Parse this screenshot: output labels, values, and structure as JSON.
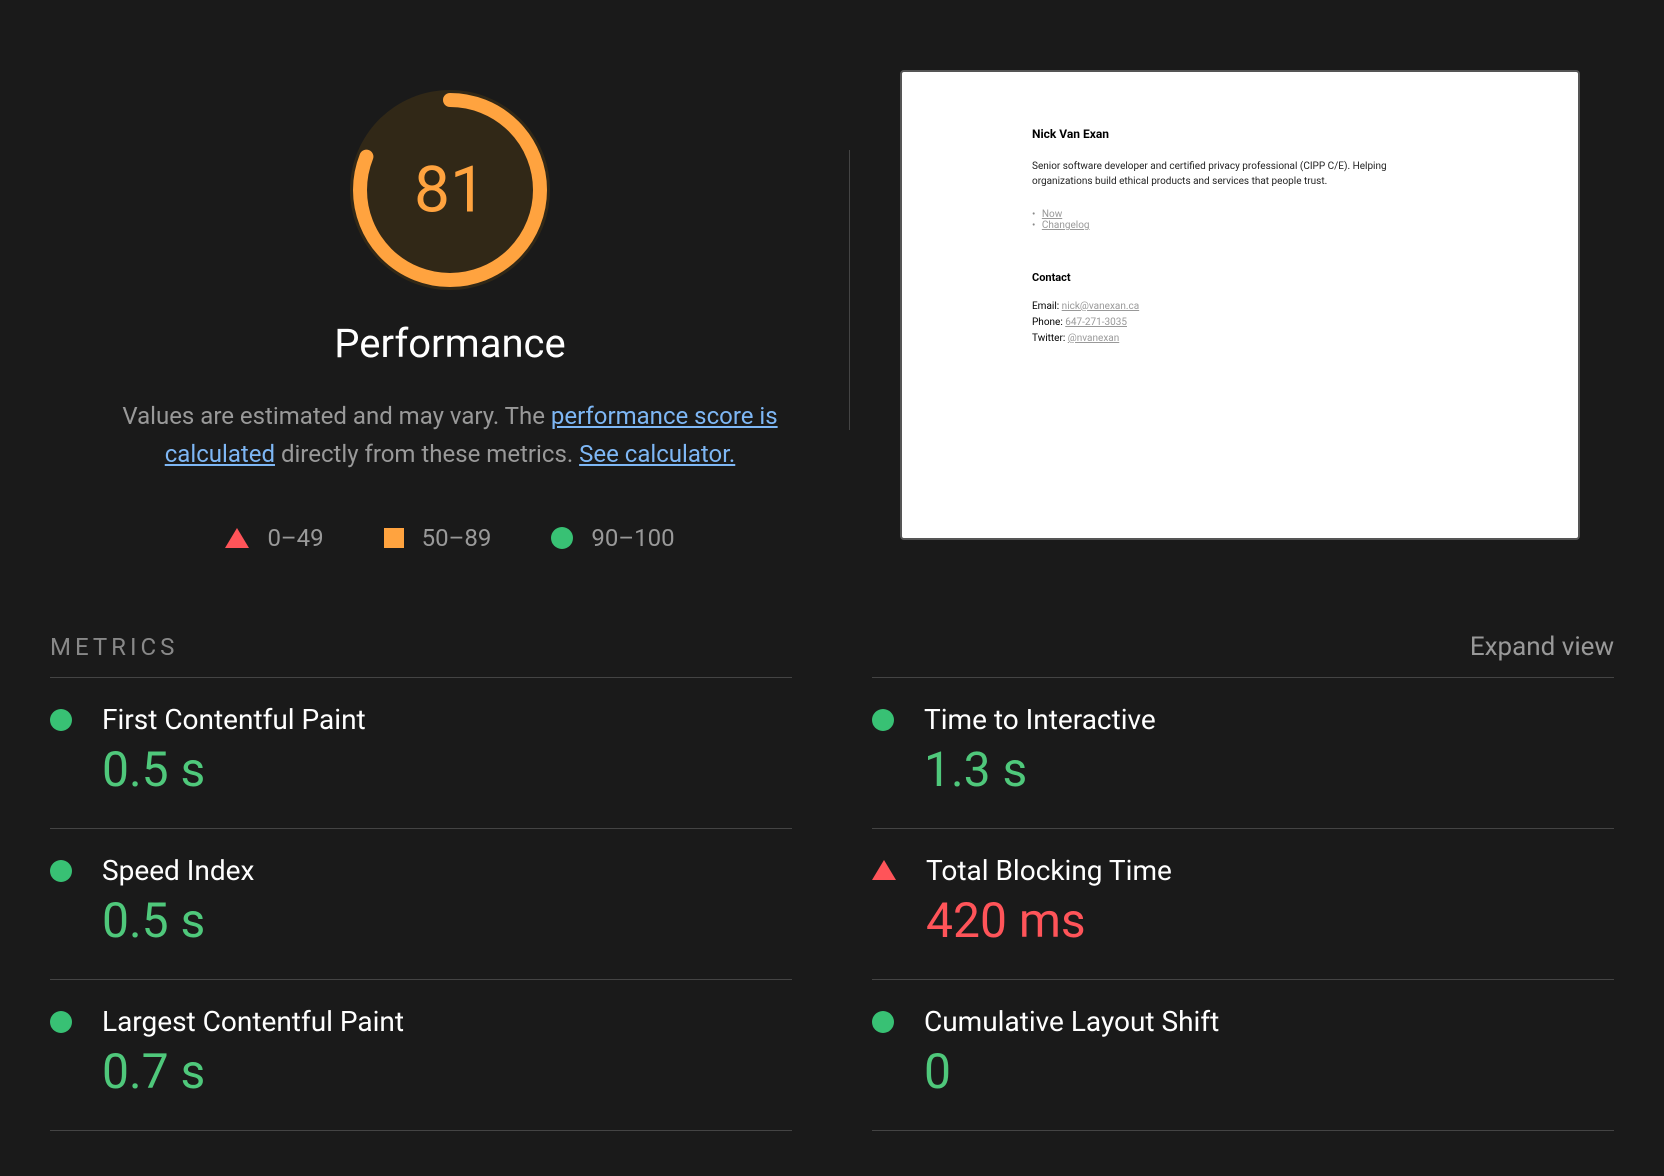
{
  "gauge": {
    "score": "81",
    "title": "Performance",
    "percent": 81
  },
  "description": {
    "prefix": "Values are estimated and may vary. The ",
    "link1": "performance score is calculated",
    "middle": " directly from these metrics. ",
    "link2": "See calculator."
  },
  "legend": {
    "fail": "0–49",
    "average": "50–89",
    "pass": "90–100"
  },
  "preview": {
    "name": "Nick Van Exan",
    "desc": "Senior software developer and certified privacy professional (CIPP C/E). Helping organizations build ethical products and services that people trust.",
    "links": [
      "Now",
      "Changelog"
    ],
    "contact_heading": "Contact",
    "email_label": "Email: ",
    "email": "nick@vanexan.ca",
    "phone_label": "Phone: ",
    "phone": "647-271-3035",
    "twitter_label": "Twitter: ",
    "twitter": "@nvanexan"
  },
  "metrics_header": {
    "title": "METRICS",
    "expand": "Expand view"
  },
  "metrics": [
    {
      "label": "First Contentful Paint",
      "value": "0.5 s",
      "status": "green"
    },
    {
      "label": "Time to Interactive",
      "value": "1.3 s",
      "status": "green"
    },
    {
      "label": "Speed Index",
      "value": "0.5 s",
      "status": "green"
    },
    {
      "label": "Total Blocking Time",
      "value": "420 ms",
      "status": "red"
    },
    {
      "label": "Largest Contentful Paint",
      "value": "0.7 s",
      "status": "green"
    },
    {
      "label": "Cumulative Layout Shift",
      "value": "0",
      "status": "green"
    }
  ]
}
